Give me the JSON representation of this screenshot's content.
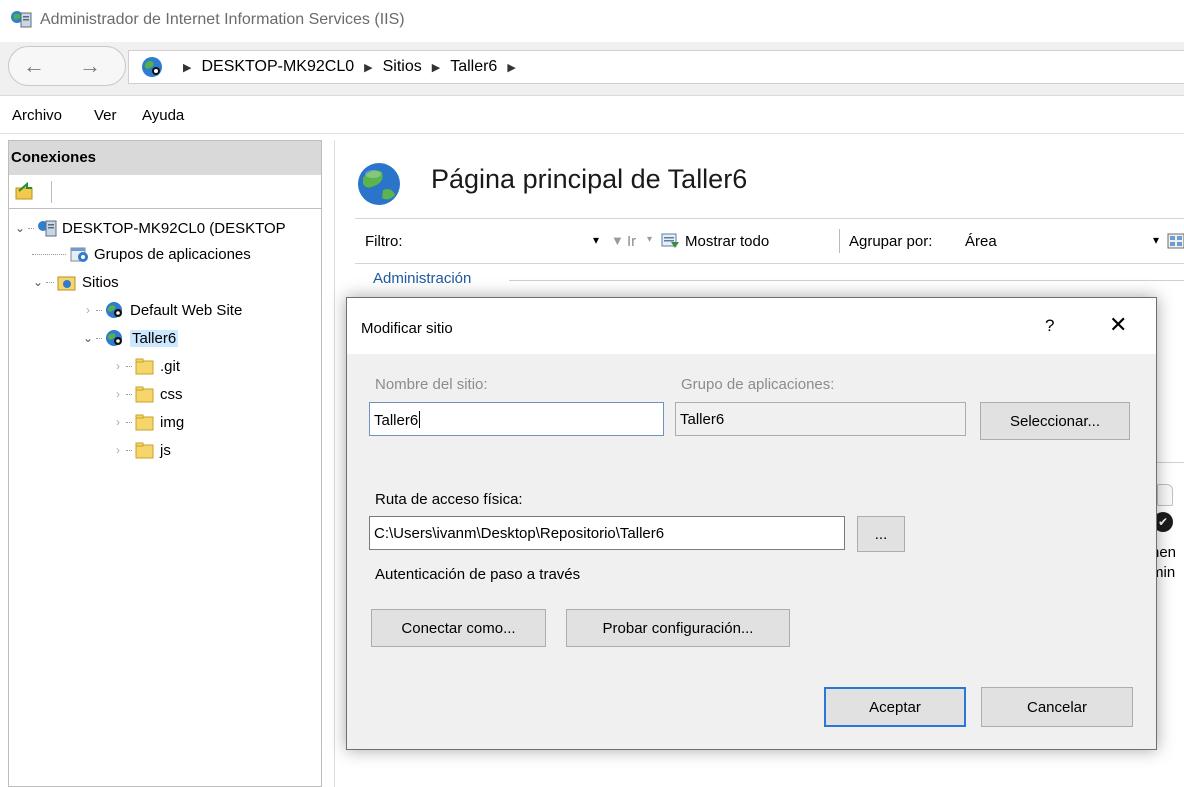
{
  "window": {
    "title": "Administrador de Internet Information Services (IIS)"
  },
  "address": {
    "crumbs": [
      "DESKTOP-MK92CL0",
      "Sitios",
      "Taller6"
    ]
  },
  "menu": {
    "items": [
      "Archivo",
      "Ver",
      "Ayuda"
    ]
  },
  "connections": {
    "title": "Conexiones",
    "tree": {
      "server": "DESKTOP-MK92CL0 (DESKTOP",
      "app_pools": "Grupos de aplicaciones",
      "sites": "Sitios",
      "default_site": "Default Web Site",
      "taller6": "Taller6",
      "folders": [
        ".git",
        "css",
        "img",
        "js"
      ]
    }
  },
  "main": {
    "title": "Página principal de Taller6",
    "filter": {
      "label": "Filtro:",
      "go": "Ir",
      "show_all": "Mostrar todo",
      "group_by_label": "Agrupar por:",
      "group_by_value": "Área"
    },
    "section": "Administración",
    "peek_text_1": "nen",
    "peek_text_2": "min"
  },
  "dialog": {
    "title": "Modificar sitio",
    "help": "?",
    "close": "✕",
    "site_name_label": "Nombre del sitio:",
    "site_name_value": "Taller6",
    "app_pool_label": "Grupo de aplicaciones:",
    "app_pool_value": "Taller6",
    "select_button": "Seleccionar...",
    "physical_path_label": "Ruta de acceso física:",
    "physical_path_value": "C:\\Users\\ivanm\\Desktop\\Repositorio\\Taller6",
    "browse_button": "...",
    "auth_text": "Autenticación de paso a través",
    "connect_as_button": "Conectar como...",
    "test_config_button": "Probar configuración...",
    "ok_button": "Aceptar",
    "cancel_button": "Cancelar"
  },
  "colors": {
    "accent": "#2978d6",
    "section_header": "#1e5aa0",
    "selection": "#cce8ff",
    "pane_header": "#d9d9d9",
    "dialog_bg": "#f0f0f0"
  }
}
